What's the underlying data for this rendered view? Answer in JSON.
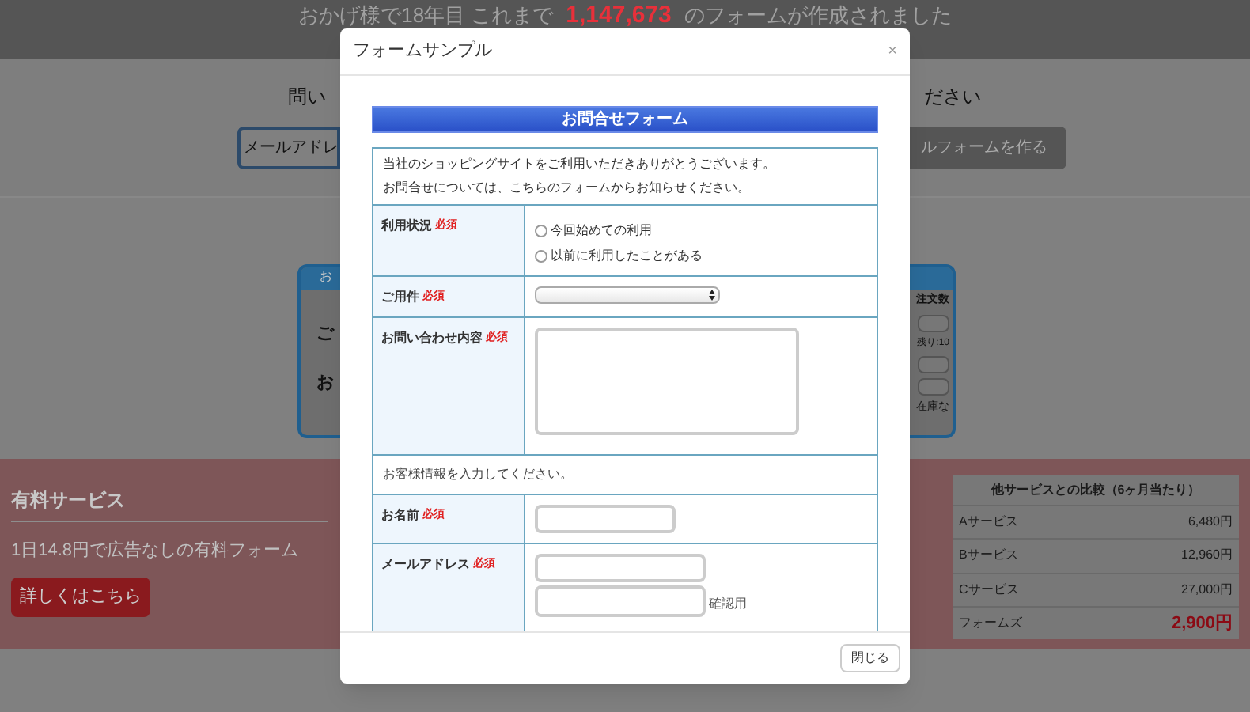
{
  "banner": {
    "prefix": "おかげ様で18年目 これまで",
    "count": "1,147,673",
    "suffix": "のフォームが作成されました"
  },
  "create_section": {
    "heading_left": "問い",
    "heading_right": "ださい",
    "input_value": "メールアドレ",
    "button": "ルフォームを作る"
  },
  "sample_card": {
    "header": "お",
    "left_cells": [
      "ご",
      "お"
    ],
    "right_header": "注文数",
    "right_notes": [
      "残り:10",
      "在庫な"
    ]
  },
  "paid_service": {
    "title": "有料サービス",
    "text": "1日14.8円で広告なしの有料フォーム",
    "button": "詳しくはこちら",
    "comparison": {
      "title": "他サービスとの比較（6ヶ月当たり）",
      "rows": [
        {
          "name": "Aサービス",
          "price": "6,480円",
          "highlight": false
        },
        {
          "name": "Bサービス",
          "price": "12,960円",
          "highlight": false
        },
        {
          "name": "Cサービス",
          "price": "27,000円",
          "highlight": false
        },
        {
          "name": "フォームズ",
          "price": "2,900円",
          "highlight": true
        }
      ]
    }
  },
  "modal": {
    "title": "フォームサンプル",
    "close_icon": "×",
    "close_button": "閉じる",
    "form": {
      "title": "お問合せフォーム",
      "intro": [
        "当社のショッピングサイトをご利用いただきありがとうございます。",
        "お問合せについては、こちらのフォームからお知らせください。"
      ],
      "rows": [
        {
          "kind": "radio",
          "label": "利用状況",
          "required_mark": "必須",
          "options": [
            {
              "label": "今回始めての利用",
              "selected": false
            },
            {
              "label": "以前に利用したことがある",
              "selected": false
            }
          ]
        },
        {
          "kind": "select",
          "label": "ご用件",
          "required_mark": "必須"
        },
        {
          "kind": "textarea",
          "label": "お問い合わせ内容",
          "required_mark": "必須"
        },
        {
          "kind": "note",
          "text": "お客様情報を入力してください。"
        },
        {
          "kind": "text",
          "label": "お名前",
          "required_mark": "必須"
        },
        {
          "kind": "email",
          "label": "メールアドレス",
          "required_mark": "必須",
          "confirm_label": "確認用"
        }
      ]
    }
  }
}
